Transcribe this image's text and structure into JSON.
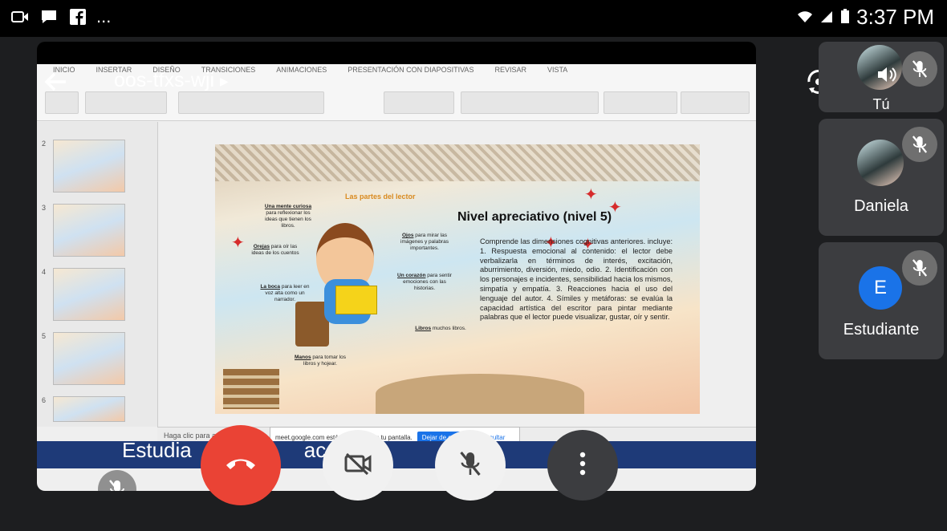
{
  "status_bar": {
    "left_icons": [
      "video-call-icon",
      "chat-icon",
      "facebook-icon"
    ],
    "overflow": "...",
    "time": "3:37 PM",
    "right_icons": [
      "wifi-icon",
      "signal-icon",
      "battery-icon"
    ]
  },
  "meeting": {
    "code": "oos-tfxs-wji",
    "self_label": "Estudia",
    "self_label_suffix": "ac"
  },
  "presentation": {
    "ribbon_tabs": [
      "INICIO",
      "INSERTAR",
      "DISEÑO",
      "TRANSICIONES",
      "ANIMACIONES",
      "PRESENTACIÓN CON DIAPOSITIVAS",
      "REVISAR",
      "VISTA"
    ],
    "thumbnail_numbers": [
      "2",
      "3",
      "4",
      "5",
      "6"
    ],
    "slide": {
      "parts_title": "Las partes del lector",
      "heading": "Nivel apreciativo (nivel 5)",
      "body": "Comprende las dimensiones cognitivas anteriores. incluye: 1. Respuesta emocional al contenido: el lector debe verbalizarla en términos de interés, excitación, aburrimiento, diversión, miedo, odio. 2. Identificación con los personajes e incidentes, sensibilidad hacia los mismos, simpatía y empatía. 3. Reacciones hacia el uso del lenguaje del autor. 4. Símiles y metáforas: se evalúa la capacidad artística del escritor para pintar mediante palabras que el lector puede visualizar, gustar, oír y sentir.",
      "callouts": [
        {
          "title": "Una mente curiosa",
          "text": "para reflexionar los ideas que tienen los libros."
        },
        {
          "title": "Orejas",
          "text": "para oír las ideas de los cuentos"
        },
        {
          "title": "La boca",
          "text": "para leer en voz alta como un narrador."
        },
        {
          "title": "Ojos",
          "text": "para mirar las imágenes y palabras importantes."
        },
        {
          "title": "Un corazón",
          "text": "para sentir emociones con las historias."
        },
        {
          "title": "Libros",
          "text": "muchos libros."
        },
        {
          "title": "Manos",
          "text": "para tomar los libros y hojear."
        }
      ]
    },
    "notes_placeholder": "Haga clic para agregar notas",
    "share_notice": {
      "text": "meet.google.com está compartiendo tu pantalla.",
      "stop_label": "Dejar de compartir",
      "hide_label": "Ocultar"
    }
  },
  "participants": [
    {
      "name": "Tú",
      "muted": true
    },
    {
      "name": "Daniela",
      "muted": true
    },
    {
      "name": "Estudiante",
      "initial": "E",
      "muted": true
    }
  ],
  "controls": {
    "end_call": "end-call-icon",
    "camera": "camera-off-icon",
    "mic": "mic-off-icon",
    "more": "more-vert-icon"
  },
  "colors": {
    "end_call": "#ea4335",
    "accent": "#1a73e8",
    "tile_bg": "#3c3d40"
  }
}
